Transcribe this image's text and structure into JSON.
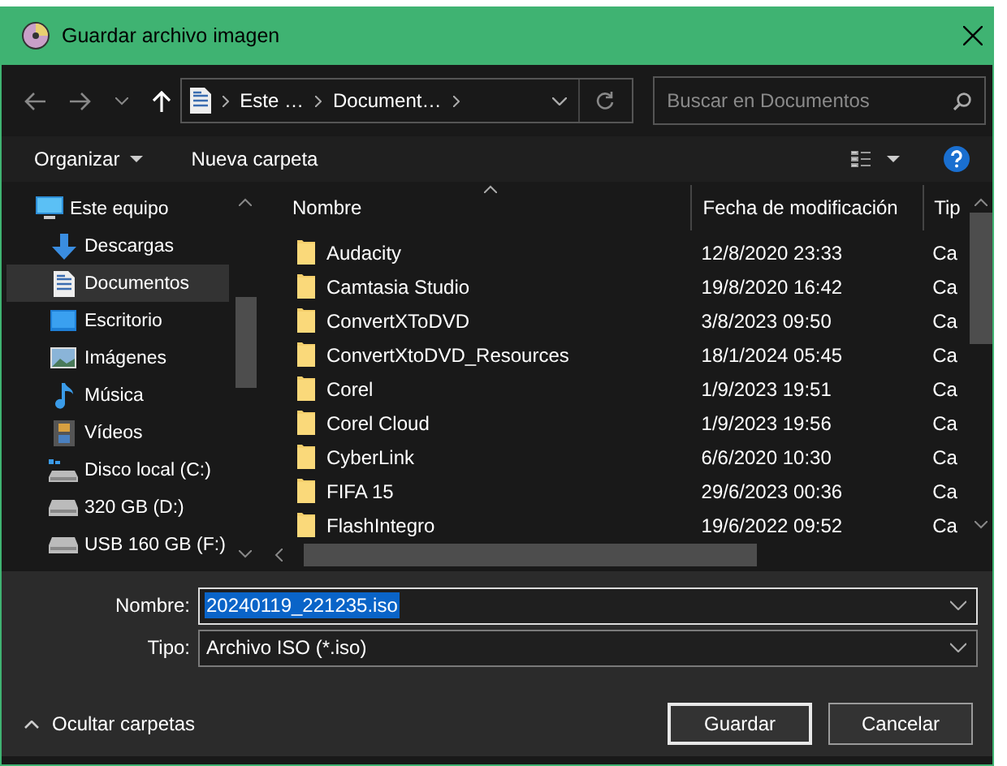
{
  "window": {
    "title": "Guardar archivo imagen"
  },
  "address": {
    "crumbs": [
      "Este …",
      "Document…"
    ]
  },
  "search": {
    "placeholder": "Buscar en Documentos"
  },
  "toolbar": {
    "organize": "Organizar",
    "new_folder": "Nueva carpeta"
  },
  "sidebar": {
    "items": [
      {
        "label": "Este equipo",
        "kind": "computer",
        "selected": false,
        "children": [
          {
            "label": "Descargas",
            "kind": "download",
            "selected": false
          },
          {
            "label": "Documentos",
            "kind": "document",
            "selected": true
          },
          {
            "label": "Escritorio",
            "kind": "desktop",
            "selected": false
          },
          {
            "label": "Imágenes",
            "kind": "pictures",
            "selected": false
          },
          {
            "label": "Música",
            "kind": "music",
            "selected": false
          },
          {
            "label": "Vídeos",
            "kind": "videos",
            "selected": false
          },
          {
            "label": "Disco local (C:)",
            "kind": "system-drive",
            "selected": false
          },
          {
            "label": "320 GB (D:)",
            "kind": "drive",
            "selected": false
          },
          {
            "label": "USB 160 GB (F:)",
            "kind": "drive",
            "selected": false
          }
        ]
      }
    ]
  },
  "file_list": {
    "columns": [
      "Nombre",
      "Fecha de modificación",
      "Tip"
    ],
    "rows": [
      {
        "name": "Audacity",
        "modified": "12/8/2020 23:33",
        "type": "Ca"
      },
      {
        "name": "Camtasia Studio",
        "modified": "19/8/2020 16:42",
        "type": "Ca"
      },
      {
        "name": "ConvertXToDVD",
        "modified": "3/8/2023 09:50",
        "type": "Ca"
      },
      {
        "name": "ConvertXtoDVD_Resources",
        "modified": "18/1/2024 05:45",
        "type": "Ca"
      },
      {
        "name": "Corel",
        "modified": "1/9/2023 19:51",
        "type": "Ca"
      },
      {
        "name": "Corel Cloud",
        "modified": "1/9/2023 19:56",
        "type": "Ca"
      },
      {
        "name": "CyberLink",
        "modified": "6/6/2020 10:30",
        "type": "Ca"
      },
      {
        "name": "FIFA 15",
        "modified": "29/6/2023 00:36",
        "type": "Ca"
      },
      {
        "name": "FlashIntegro",
        "modified": "19/6/2022 09:52",
        "type": "Ca"
      }
    ]
  },
  "footer": {
    "filename": {
      "label": "Nombre:",
      "value": "20240119_221235.iso",
      "selected": true
    },
    "file_type": {
      "label": "Tipo:",
      "value": "Archivo ISO (*.iso)"
    },
    "hide_folders": "Ocultar carpetas",
    "buttons": [
      {
        "label": "Guardar",
        "default": true
      },
      {
        "label": "Cancelar",
        "default": false
      }
    ]
  }
}
